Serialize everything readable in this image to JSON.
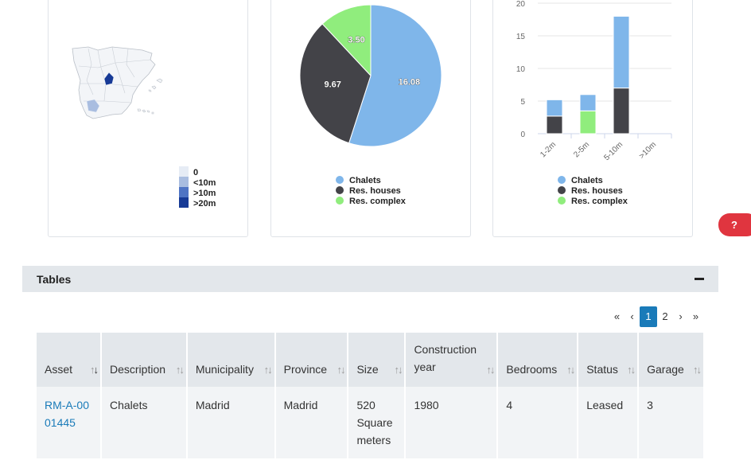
{
  "map_card": {
    "legend": [
      "0",
      "<10m",
      ">10m",
      ">20m"
    ],
    "legend_colors": [
      "#e6ecf5",
      "#a9bde0",
      "#4f74c4",
      "#173a96"
    ]
  },
  "pie_card": {
    "chart_data": {
      "type": "pie",
      "labels": [
        "Chalets",
        "Res. houses",
        "Res. complex"
      ],
      "values": [
        16.08,
        9.67,
        3.5
      ],
      "value_labels": [
        "16.08",
        "9.67",
        "3.50"
      ],
      "colors": [
        "#7fb6ea",
        "#434348",
        "#90ed7d"
      ],
      "legend_position": "bottom"
    }
  },
  "bar_card": {
    "chart_data": {
      "type": "bar",
      "stacked": true,
      "categories": [
        "1-2m",
        "2-5m",
        "5-10m",
        ">10m"
      ],
      "series": [
        {
          "name": "Chalets",
          "values": [
            2.5,
            2.5,
            11,
            0
          ],
          "color": "#7fb6ea"
        },
        {
          "name": "Res. houses",
          "values": [
            2.7,
            0,
            7,
            0
          ],
          "color": "#434348"
        },
        {
          "name": "Res. complex",
          "values": [
            0,
            3.5,
            0,
            0
          ],
          "color": "#90ed7d"
        }
      ],
      "y_ticks": [
        "0",
        "5",
        "10",
        "15",
        "20"
      ],
      "ylim": [
        0,
        20
      ],
      "legend_position": "bottom"
    }
  },
  "help_label": "?",
  "tables_section": {
    "title": "Tables",
    "pagination": {
      "first": "«",
      "prev": "‹",
      "pages": [
        "1",
        "2"
      ],
      "active": "1",
      "next": "›",
      "last": "»"
    },
    "columns": [
      "Asset",
      "Description",
      "Municipality",
      "Province",
      "Size",
      "Construction year",
      "Bedrooms",
      "Status",
      "Garage"
    ],
    "rows": [
      {
        "asset": "RM-A-0001445",
        "description": "Chalets",
        "municipality": "Madrid",
        "province": "Madrid",
        "size": "520 Square meters",
        "construction_year": "1980",
        "bedrooms": "4",
        "status": "Leased",
        "garage": "3"
      }
    ]
  }
}
